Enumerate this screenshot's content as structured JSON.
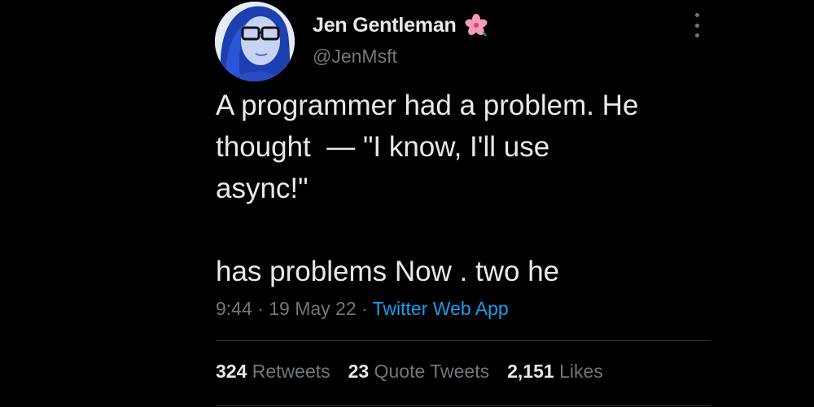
{
  "author": {
    "display_name": "Jen Gentleman",
    "handle": "@JenMsft",
    "avatar_icon": "profile-photo",
    "badge_icon": "hibiscus-emoji"
  },
  "tweet": {
    "lines": [
      "A programmer had a problem. He",
      "thought  — \"I know, I'll use",
      "async!\"",
      "",
      "has problems Now . two he"
    ],
    "time": "9:44",
    "separator": " · ",
    "date": "19 May 22",
    "source": "Twitter Web App"
  },
  "stats": {
    "retweets_count": "324",
    "retweets_label": "Retweets",
    "quotes_count": "23",
    "quotes_label": "Quote Tweets",
    "likes_count": "2,151",
    "likes_label": "Likes"
  },
  "colors": {
    "background": "#000000",
    "text": "#e7e9ea",
    "secondary": "#71767b",
    "link": "#1d9bf0",
    "divider": "#2f3336"
  }
}
